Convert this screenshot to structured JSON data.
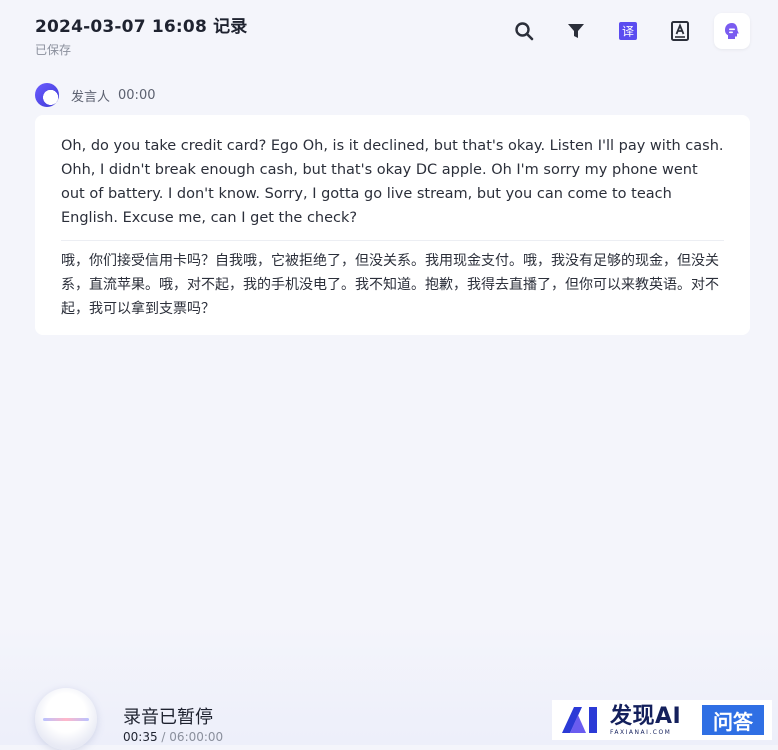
{
  "header": {
    "title": "2024-03-07 16:08 记录",
    "status": "已保存",
    "tools": [
      {
        "name": "search-icon"
      },
      {
        "name": "filter-icon"
      },
      {
        "name": "translate-icon"
      },
      {
        "name": "font-icon"
      },
      {
        "name": "ai-assistant-icon"
      }
    ]
  },
  "speaker": {
    "name": "发言人",
    "time": "00:00"
  },
  "transcript": {
    "english": "Oh, do you take credit card? Ego Oh, is it declined, but that's okay. Listen I'll pay with cash. Ohh, I didn't break enough cash, but that's okay DC apple. Oh I'm sorry my phone went out of battery. I don't know. Sorry, I gotta go live stream, but you can come to teach English. Excuse me, can I get the check?",
    "chinese": "哦，你们接受信用卡吗？自我哦，它被拒绝了，但没关系。我用现金支付。哦，我没有足够的现金，但没关系，直流苹果。哦，对不起，我的手机没电了。我不知道。抱歉，我得去直播了，但你可以来教英语。对不起，我可以拿到支票吗？"
  },
  "recorder": {
    "status": "录音已暂停",
    "current": "00:35",
    "separator": "/",
    "total": "06:00:00"
  },
  "watermark": {
    "brand": "发现AI",
    "domain": "FAXIANAI.COM",
    "badge": "问答"
  },
  "colors": {
    "accent": "#5b4cf0",
    "icon": "#2b2f3a",
    "background": "#f4f5fb",
    "watermark_badge": "#2f6fe4"
  }
}
